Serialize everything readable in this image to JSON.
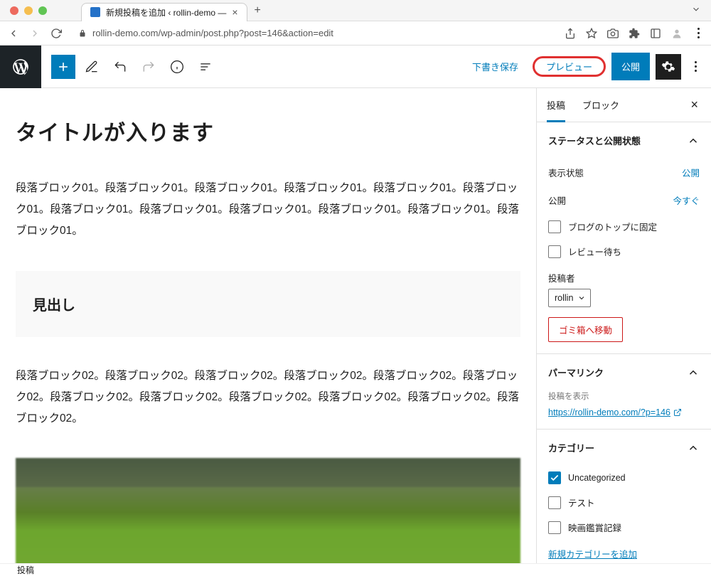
{
  "browser": {
    "tab_title": "新規投稿を追加 ‹ rollin-demo —",
    "url": "rollin-demo.com/wp-admin/post.php?post=146&action=edit"
  },
  "toolbar": {
    "save_draft": "下書き保存",
    "preview": "プレビュー",
    "publish": "公開"
  },
  "post": {
    "title": "タイトルが入ります",
    "paragraph1": "段落ブロック01。段落ブロック01。段落ブロック01。段落ブロック01。段落ブロック01。段落ブロック01。段落ブロック01。段落ブロック01。段落ブロック01。段落ブロック01。段落ブロック01。段落ブロック01。",
    "heading": "見出し",
    "paragraph2": "段落ブロック02。段落ブロック02。段落ブロック02。段落ブロック02。段落ブロック02。段落ブロック02。段落ブロック02。段落ブロック02。段落ブロック02。段落ブロック02。段落ブロック02。段落ブロック02。"
  },
  "sidebar": {
    "tab_post": "投稿",
    "tab_block": "ブロック",
    "status": {
      "title": "ステータスと公開状態",
      "visibility_label": "表示状態",
      "visibility_value": "公開",
      "publish_label": "公開",
      "publish_value": "今すぐ",
      "stick_top": "ブログのトップに固定",
      "pending_review": "レビュー待ち",
      "author_label": "投稿者",
      "author_value": "rollin",
      "trash": "ゴミ箱へ移動"
    },
    "permalink": {
      "title": "パーマリンク",
      "view_post": "投稿を表示",
      "url": "https://rollin-demo.com/?p=146"
    },
    "categories": {
      "title": "カテゴリー",
      "items": [
        "Uncategorized",
        "テスト",
        "映画鑑賞記録"
      ],
      "add_new": "新規カテゴリーを追加"
    }
  },
  "footer": {
    "breadcrumb": "投稿"
  }
}
